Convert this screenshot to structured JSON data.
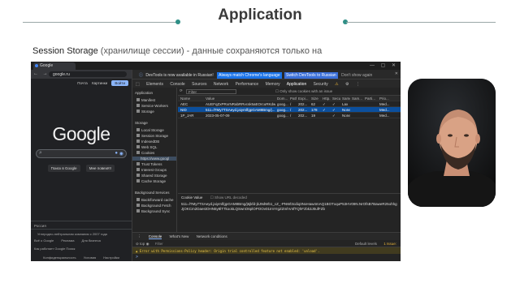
{
  "slide": {
    "title": "Application",
    "subtitle_term": "Session Storage",
    "subtitle_rest": " (хранилище сессии) - данные сохраняются только на"
  },
  "browser": {
    "tab_title": "Google",
    "url": "google.ru"
  },
  "google": {
    "top_links": [
      "Почта",
      "Картинки"
    ],
    "signin": "Войти",
    "logo": "Google",
    "btn_search": "Поиск в Google",
    "btn_lucky": "Мне повезёт!",
    "footer_country": "Россия",
    "footer_carbon": "Углеродно-нейтральная компания с 2007 года",
    "footer_links1": [
      "Всё о Google",
      "Реклама",
      "Для бизнеса"
    ],
    "footer_link2": "Как работает Google Поиск",
    "footer_links3": [
      "Конфиденциальность",
      "Условия",
      "Настройки"
    ]
  },
  "devtools": {
    "notice": "DevTools is now available in Russian!",
    "notice_btn1": "Always match Chrome's language",
    "notice_btn2": "Switch DevTools to Russian",
    "notice_btn3": "Don't show again",
    "tabs": [
      "Elements",
      "Console",
      "Sources",
      "Network",
      "Performance",
      "Memory",
      "Application",
      "Security"
    ],
    "active_tab": "Application",
    "sidebar": {
      "sec_app": "Application",
      "app_items": [
        "Manifest",
        "Service Workers",
        "Storage"
      ],
      "sec_storage": "Storage",
      "storage_items": [
        "Local Storage",
        "Session Storage",
        "IndexedDB",
        "Web SQL",
        "Cookies"
      ],
      "cookie_origin": "https://www.googl",
      "storage_items2": [
        "Trust Tokens",
        "Interest Groups",
        "Shared Storage",
        "Cache Storage"
      ],
      "sec_bg": "Background Services",
      "bg_items": [
        "Back/forward cache",
        "Background Fetch",
        "Background Sync"
      ]
    },
    "filter_placeholder": "Filter",
    "filter_checkbox": "Only show cookies with an issue",
    "columns": [
      "Name",
      "Value",
      "Dom...",
      "Path",
      "Expi...",
      "Size",
      "Http...",
      "Secu...",
      "Same...",
      "Sam...",
      "Parti...",
      "Prio..."
    ],
    "rows": [
      [
        "AEC",
        "AUEFqZxPRxrNRabRRvcsk5aEOrcuRKdw...",
        "goog...",
        "/",
        "202...",
        "62",
        "✓",
        "✓",
        "Lax",
        "",
        "",
        "Med..."
      ],
      [
        "NID",
        "511=lTMy7TSAeyd.jaiyrnlfgpGAM8Bmg/j...",
        "goog...",
        "/",
        "202...",
        "178",
        "✓",
        "✓",
        "None",
        "",
        "",
        "Med..."
      ],
      [
        "1P_JAR",
        "2023-05-07-09",
        "goog...",
        "/",
        "202...",
        "19",
        "",
        "✓",
        "None",
        "",
        "",
        "Med..."
      ]
    ],
    "selected_row": 1,
    "cookie_value_label": "Cookie Value",
    "show_url_decoded": "Show URL decoded",
    "cookie_value": "511=lTMy7TSAeyd.jaiyrnlfgpGAM8Bmg/j6jkfd-jkJ9dWb1_cZ_-PNWl3cdiq3NoHaw4mAQ1BOTxquP53HV09N.NrOfsB7BaweR25ohhgJjOKCm2DaestOHN5y8lT7kookLQSwnO6plOPOOv01ImYrgZZmhV4fTQhFzbk3J0ufFZb"
  },
  "console": {
    "tabs": [
      "Console",
      "What's New",
      "Network conditions"
    ],
    "context": "top",
    "filter": "Filter",
    "levels": "Default levels",
    "issues": "1 Issue:",
    "warning": "Error with Permissions-Policy header: Origin trial controlled feature not enabled: 'unload'.",
    "prompt": ">"
  }
}
